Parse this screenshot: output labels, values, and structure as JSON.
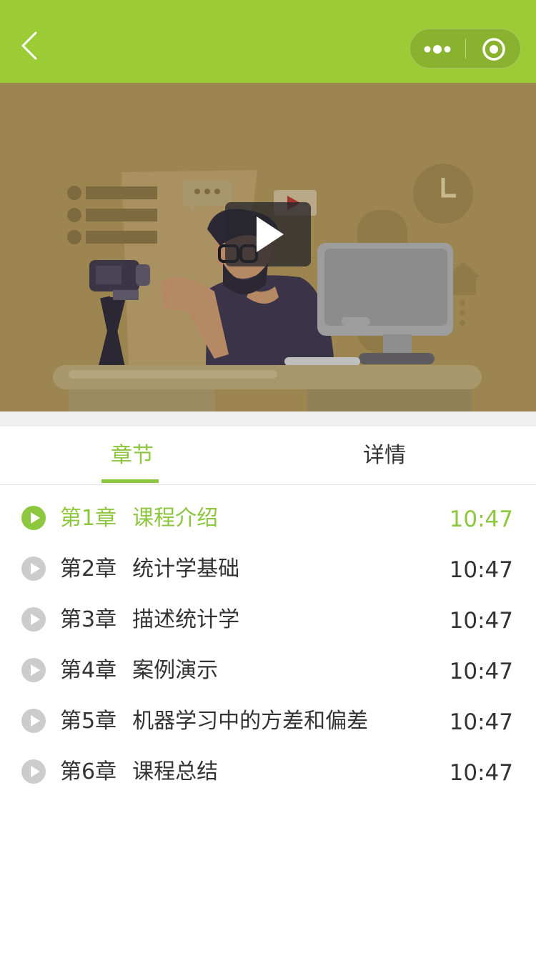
{
  "nav": {
    "back_icon": "chevron-left-icon",
    "more_icon": "more-dots-icon",
    "close_icon": "target-close-icon",
    "bar_color": "#9ccc35"
  },
  "video": {
    "play_icon": "play-icon",
    "background_color": "#9c8550"
  },
  "tabs": [
    {
      "label": "章节",
      "active": true
    },
    {
      "label": "详情",
      "active": false
    }
  ],
  "chapters": [
    {
      "number": "第1章",
      "name": "课程介绍",
      "duration": "10:47",
      "active": true
    },
    {
      "number": "第2章",
      "name": "统计学基础",
      "duration": "10:47",
      "active": false
    },
    {
      "number": "第3章",
      "name": "描述统计学",
      "duration": "10:47",
      "active": false
    },
    {
      "number": "第4章",
      "name": "案例演示",
      "duration": "10:47",
      "active": false
    },
    {
      "number": "第5章",
      "name": "机器学习中的方差和偏差",
      "duration": "10:47",
      "active": false
    },
    {
      "number": "第6章",
      "name": "课程总结",
      "duration": "10:47",
      "active": false
    }
  ],
  "colors": {
    "accent": "#8dc63f",
    "text": "#333333",
    "icon_inactive": "#cccccc"
  }
}
